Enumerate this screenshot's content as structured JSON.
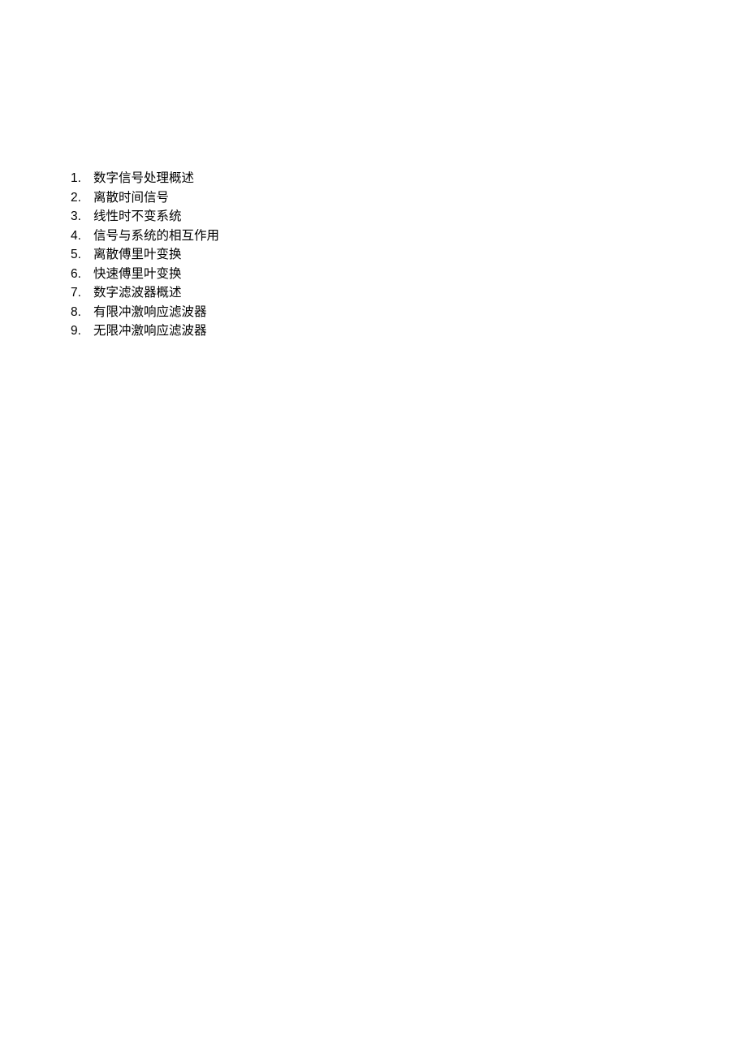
{
  "list": {
    "items": [
      {
        "number": "1.",
        "text": "数字信号处理概述"
      },
      {
        "number": "2.",
        "text": "离散时间信号"
      },
      {
        "number": "3.",
        "text": "线性时不变系统"
      },
      {
        "number": "4.",
        "text": "信号与系统的相互作用"
      },
      {
        "number": "5.",
        "text": "离散傅里叶变换"
      },
      {
        "number": "6.",
        "text": "快速傅里叶变换"
      },
      {
        "number": "7.",
        "text": "数字滤波器概述"
      },
      {
        "number": "8.",
        "text": "有限冲激响应滤波器"
      },
      {
        "number": "9.",
        "text": "无限冲激响应滤波器"
      }
    ]
  }
}
